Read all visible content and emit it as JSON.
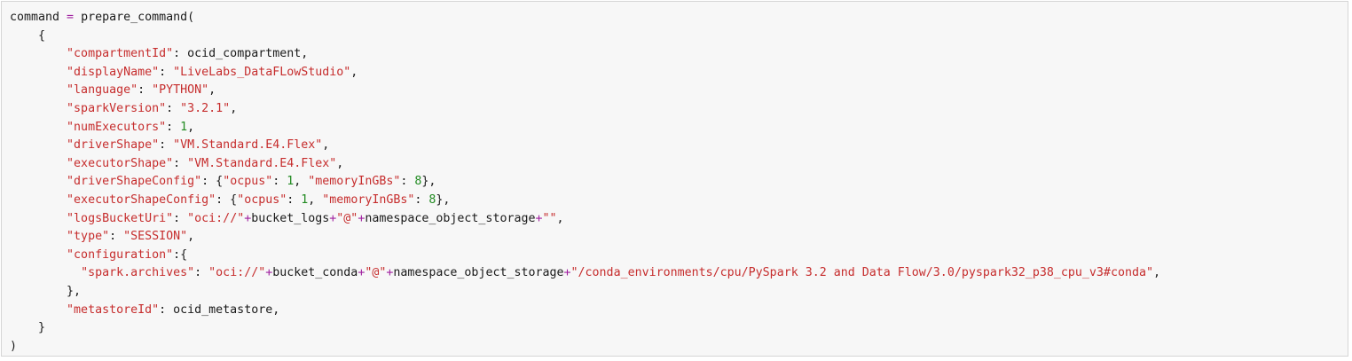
{
  "colors": {
    "background": "#f7f7f7",
    "border": "#d6d6d6",
    "string": "#c62d2d",
    "number": "#228b22",
    "operator": "#a020a0",
    "text": "#1a1a1a"
  },
  "code": {
    "language": "python",
    "lines": [
      [
        {
          "t": "command ",
          "k": "plain"
        },
        {
          "t": "=",
          "k": "op"
        },
        {
          "t": " prepare_command(",
          "k": "plain"
        }
      ],
      [
        {
          "t": "    {",
          "k": "plain"
        }
      ],
      [
        {
          "t": "        ",
          "k": "plain"
        },
        {
          "t": "\"compartmentId\"",
          "k": "str"
        },
        {
          "t": ": ocid_compartment,",
          "k": "plain"
        }
      ],
      [
        {
          "t": "        ",
          "k": "plain"
        },
        {
          "t": "\"displayName\"",
          "k": "str"
        },
        {
          "t": ": ",
          "k": "plain"
        },
        {
          "t": "\"LiveLabs_DataFLowStudio\"",
          "k": "str"
        },
        {
          "t": ",",
          "k": "plain"
        }
      ],
      [
        {
          "t": "        ",
          "k": "plain"
        },
        {
          "t": "\"language\"",
          "k": "str"
        },
        {
          "t": ": ",
          "k": "plain"
        },
        {
          "t": "\"PYTHON\"",
          "k": "str"
        },
        {
          "t": ",",
          "k": "plain"
        }
      ],
      [
        {
          "t": "        ",
          "k": "plain"
        },
        {
          "t": "\"sparkVersion\"",
          "k": "str"
        },
        {
          "t": ": ",
          "k": "plain"
        },
        {
          "t": "\"3.2.1\"",
          "k": "str"
        },
        {
          "t": ",",
          "k": "plain"
        }
      ],
      [
        {
          "t": "        ",
          "k": "plain"
        },
        {
          "t": "\"numExecutors\"",
          "k": "str"
        },
        {
          "t": ": ",
          "k": "plain"
        },
        {
          "t": "1",
          "k": "num"
        },
        {
          "t": ",",
          "k": "plain"
        }
      ],
      [
        {
          "t": "        ",
          "k": "plain"
        },
        {
          "t": "\"driverShape\"",
          "k": "str"
        },
        {
          "t": ": ",
          "k": "plain"
        },
        {
          "t": "\"VM.Standard.E4.Flex\"",
          "k": "str"
        },
        {
          "t": ",",
          "k": "plain"
        }
      ],
      [
        {
          "t": "        ",
          "k": "plain"
        },
        {
          "t": "\"executorShape\"",
          "k": "str"
        },
        {
          "t": ": ",
          "k": "plain"
        },
        {
          "t": "\"VM.Standard.E4.Flex\"",
          "k": "str"
        },
        {
          "t": ",",
          "k": "plain"
        }
      ],
      [
        {
          "t": "        ",
          "k": "plain"
        },
        {
          "t": "\"driverShapeConfig\"",
          "k": "str"
        },
        {
          "t": ": {",
          "k": "plain"
        },
        {
          "t": "\"ocpus\"",
          "k": "str"
        },
        {
          "t": ": ",
          "k": "plain"
        },
        {
          "t": "1",
          "k": "num"
        },
        {
          "t": ", ",
          "k": "plain"
        },
        {
          "t": "\"memoryInGBs\"",
          "k": "str"
        },
        {
          "t": ": ",
          "k": "plain"
        },
        {
          "t": "8",
          "k": "num"
        },
        {
          "t": "},",
          "k": "plain"
        }
      ],
      [
        {
          "t": "        ",
          "k": "plain"
        },
        {
          "t": "\"executorShapeConfig\"",
          "k": "str"
        },
        {
          "t": ": {",
          "k": "plain"
        },
        {
          "t": "\"ocpus\"",
          "k": "str"
        },
        {
          "t": ": ",
          "k": "plain"
        },
        {
          "t": "1",
          "k": "num"
        },
        {
          "t": ", ",
          "k": "plain"
        },
        {
          "t": "\"memoryInGBs\"",
          "k": "str"
        },
        {
          "t": ": ",
          "k": "plain"
        },
        {
          "t": "8",
          "k": "num"
        },
        {
          "t": "},",
          "k": "plain"
        }
      ],
      [
        {
          "t": "        ",
          "k": "plain"
        },
        {
          "t": "\"logsBucketUri\"",
          "k": "str"
        },
        {
          "t": ": ",
          "k": "plain"
        },
        {
          "t": "\"oci://\"",
          "k": "str"
        },
        {
          "t": "+",
          "k": "op"
        },
        {
          "t": "bucket_logs",
          "k": "plain"
        },
        {
          "t": "+",
          "k": "op"
        },
        {
          "t": "\"@\"",
          "k": "str"
        },
        {
          "t": "+",
          "k": "op"
        },
        {
          "t": "namespace_object_storage",
          "k": "plain"
        },
        {
          "t": "+",
          "k": "op"
        },
        {
          "t": "\"\"",
          "k": "str"
        },
        {
          "t": ",",
          "k": "plain"
        }
      ],
      [
        {
          "t": "        ",
          "k": "plain"
        },
        {
          "t": "\"type\"",
          "k": "str"
        },
        {
          "t": ": ",
          "k": "plain"
        },
        {
          "t": "\"SESSION\"",
          "k": "str"
        },
        {
          "t": ",",
          "k": "plain"
        }
      ],
      [
        {
          "t": "        ",
          "k": "plain"
        },
        {
          "t": "\"configuration\"",
          "k": "str"
        },
        {
          "t": ":{",
          "k": "plain"
        }
      ],
      [
        {
          "t": "          ",
          "k": "plain"
        },
        {
          "t": "\"spark.archives\"",
          "k": "str"
        },
        {
          "t": ": ",
          "k": "plain"
        },
        {
          "t": "\"oci://\"",
          "k": "str"
        },
        {
          "t": "+",
          "k": "op"
        },
        {
          "t": "bucket_conda",
          "k": "plain"
        },
        {
          "t": "+",
          "k": "op"
        },
        {
          "t": "\"@\"",
          "k": "str"
        },
        {
          "t": "+",
          "k": "op"
        },
        {
          "t": "namespace_object_storage",
          "k": "plain"
        },
        {
          "t": "+",
          "k": "op"
        },
        {
          "t": "\"/conda_environments/cpu/PySpark 3.2 and Data Flow/3.0/pyspark32_p38_cpu_v3#conda\"",
          "k": "str"
        },
        {
          "t": ",",
          "k": "plain"
        }
      ],
      [
        {
          "t": "        },",
          "k": "plain"
        }
      ],
      [
        {
          "t": "        ",
          "k": "plain"
        },
        {
          "t": "\"metastoreId\"",
          "k": "str"
        },
        {
          "t": ": ocid_metastore,",
          "k": "plain"
        }
      ],
      [
        {
          "t": "    }",
          "k": "plain"
        }
      ],
      [
        {
          "t": ")",
          "k": "plain"
        }
      ]
    ]
  }
}
